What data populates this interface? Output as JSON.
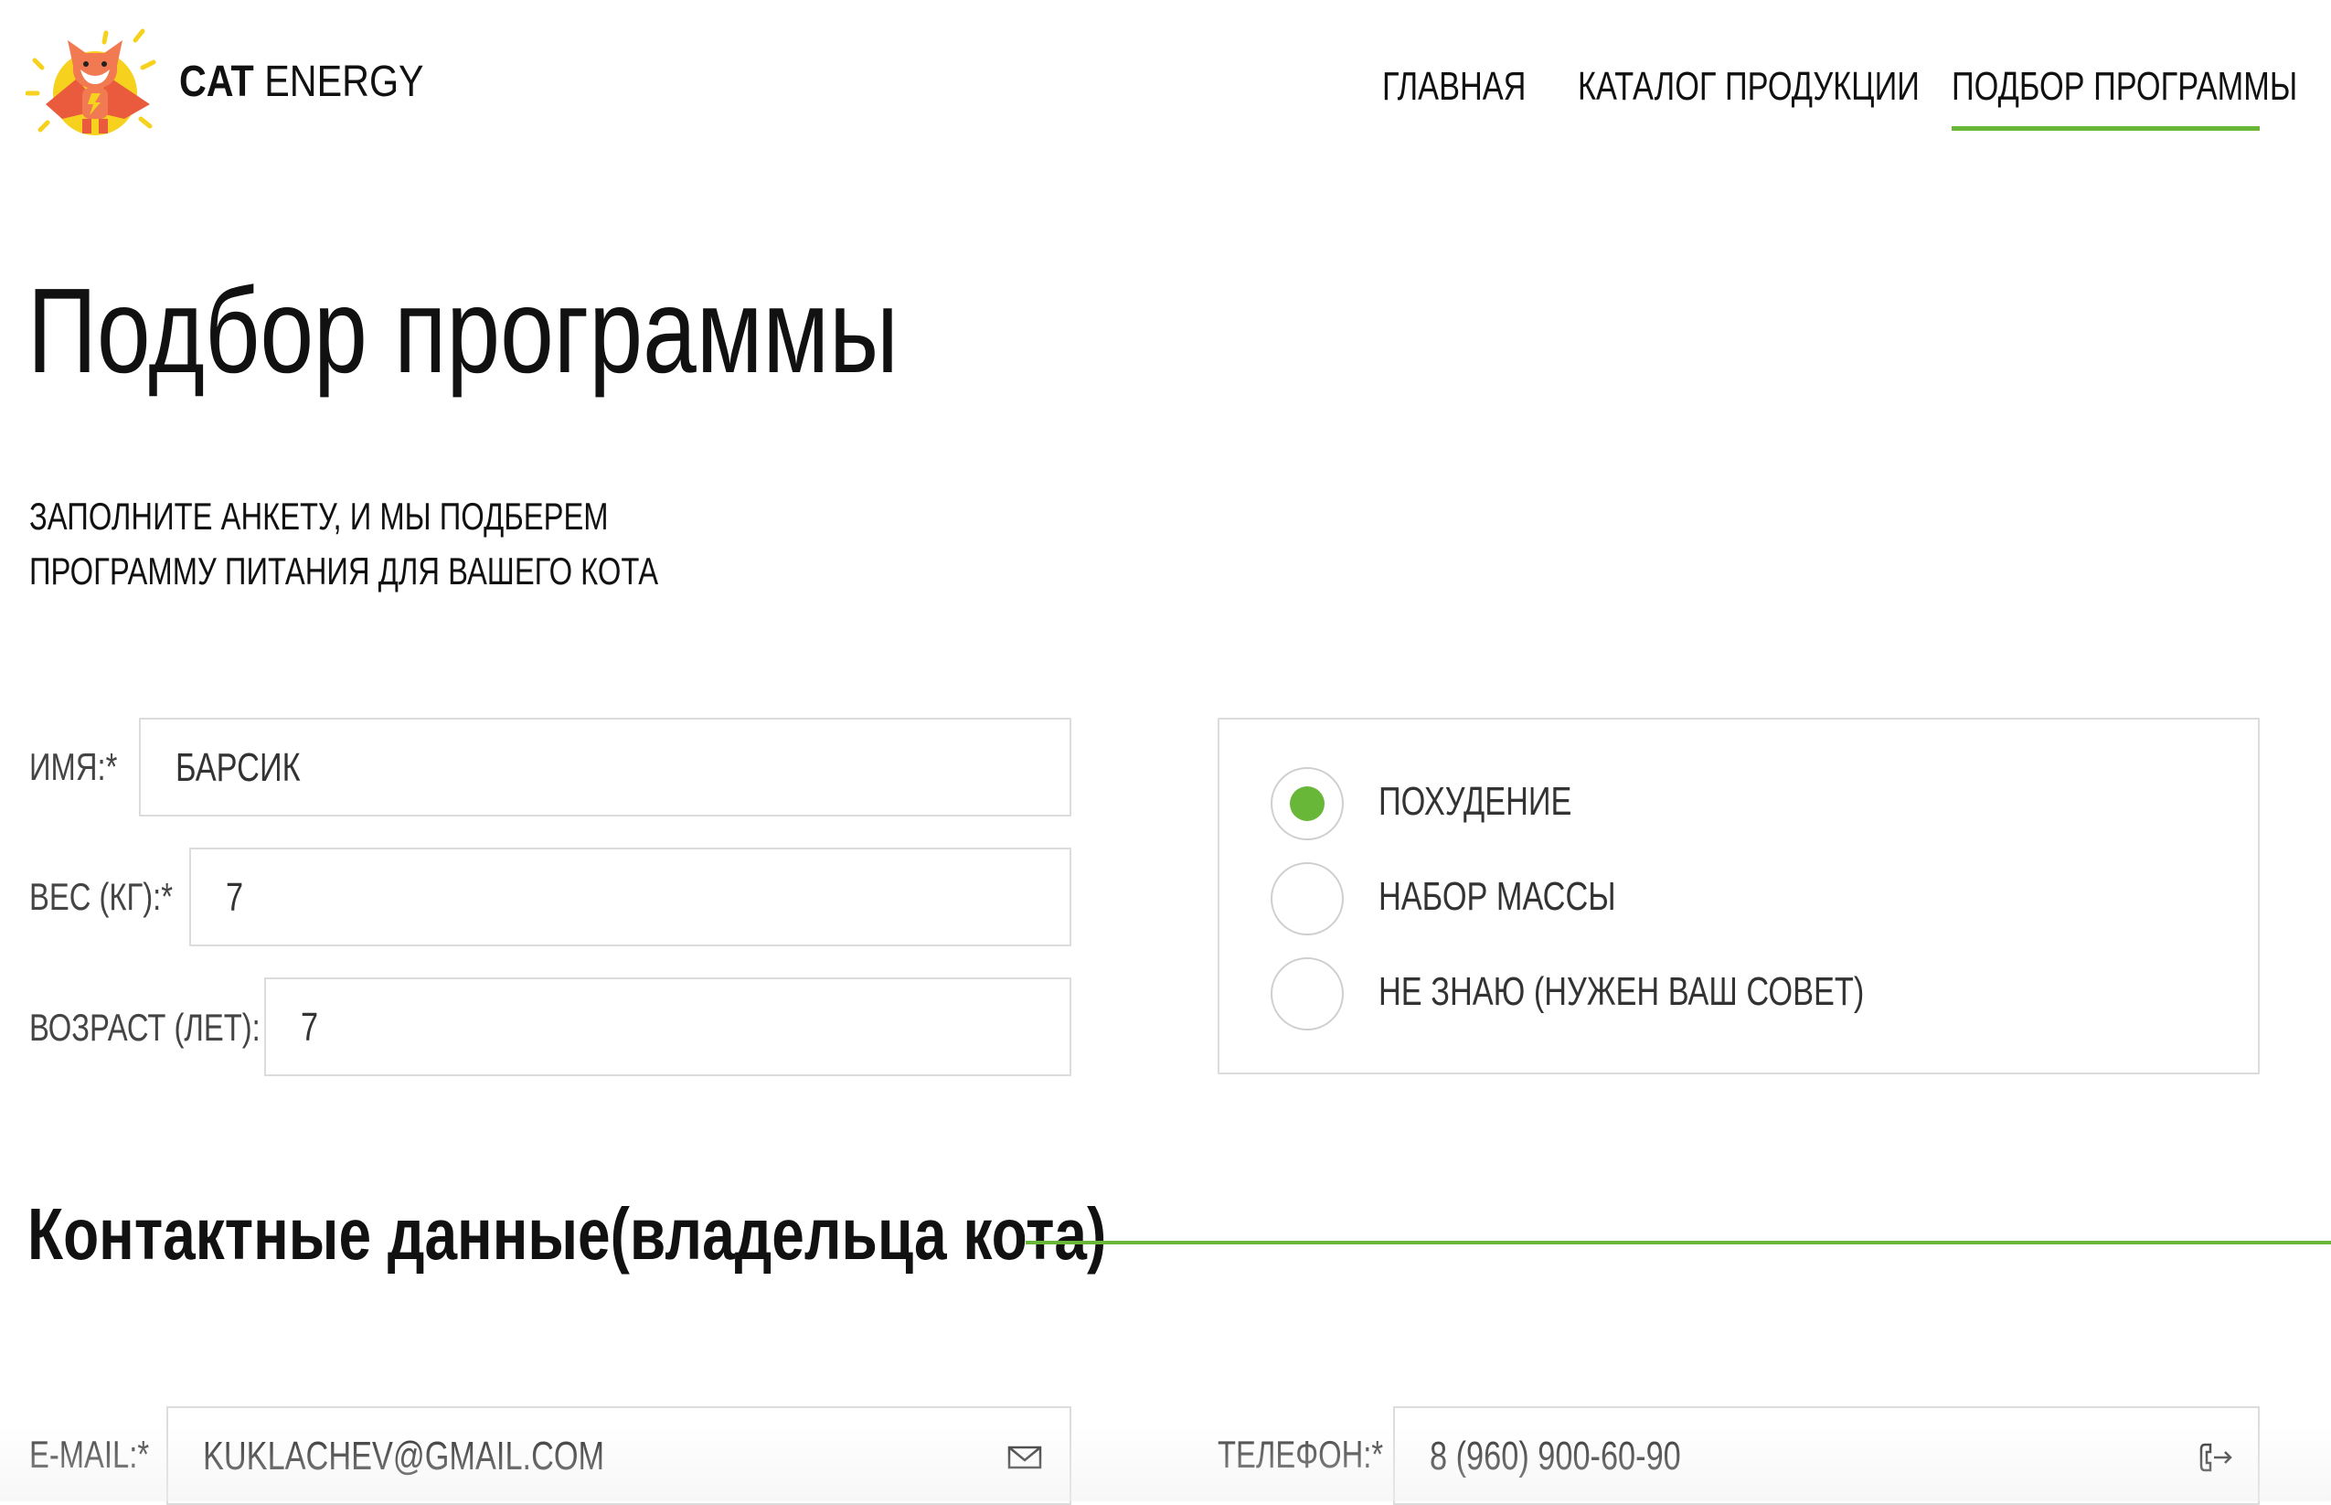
{
  "header": {
    "brand_bold": "CAT",
    "brand_rest": "ENERGY",
    "nav": [
      {
        "label": "ГЛАВНАЯ",
        "active": false
      },
      {
        "label": "КАТАЛОГ ПРОДУКЦИИ",
        "active": false
      },
      {
        "label": "ПОДБОР ПРОГРАММЫ",
        "active": true
      }
    ]
  },
  "page": {
    "title": "Подбор программы",
    "intro_line1": "ЗАПОЛНИТЕ АНКЕТУ, И МЫ ПОДБЕРЕМ",
    "intro_line2": "ПРОГРАММУ ПИТАНИЯ ДЛЯ ВАШЕГО КОТА"
  },
  "form": {
    "name": {
      "label": "ИМЯ:*",
      "value": "БАРСИК"
    },
    "weight": {
      "label": "ВЕС (КГ):*",
      "value": "7"
    },
    "age": {
      "label": "ВОЗРАСТ (ЛЕТ):",
      "value": "7"
    },
    "goals": [
      {
        "label": "ПОХУДЕНИЕ",
        "checked": true
      },
      {
        "label": "НАБОР МАССЫ",
        "checked": false
      },
      {
        "label": "НЕ ЗНАЮ (НУЖЕН ВАШ СОВЕТ)",
        "checked": false
      }
    ]
  },
  "contacts": {
    "title": "Контактные данные(владельца кота)",
    "email": {
      "label": "E-MAIL:*",
      "value": "KUKLACHEV@GMAIL.COM",
      "icon": "mail-icon"
    },
    "phone": {
      "label": "ТЕЛЕФОН:*",
      "value": "8 (960) 900-60-90",
      "icon": "phone-icon"
    }
  },
  "colors": {
    "accent": "#68b738",
    "text": "#111111",
    "border": "#dcdcdc"
  }
}
